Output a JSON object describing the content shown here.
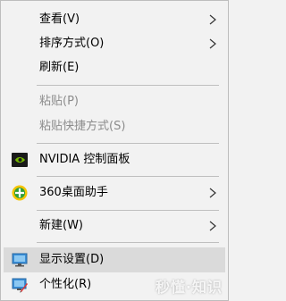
{
  "menu": {
    "items": [
      {
        "label": "查看(V)"
      },
      {
        "label": "排序方式(O)"
      },
      {
        "label": "刷新(E)"
      },
      {
        "label": "粘贴(P)"
      },
      {
        "label": "粘贴快捷方式(S)"
      },
      {
        "label": "NVIDIA 控制面板",
        "icon": "nvidia-icon"
      },
      {
        "label": "360桌面助手",
        "icon": "360-icon"
      },
      {
        "label": "新建(W)"
      },
      {
        "label": "显示设置(D)",
        "icon": "display-icon"
      },
      {
        "label": "个性化(R)",
        "icon": "personalize-icon"
      }
    ]
  },
  "watermark": "秒懂·知识",
  "colors": {
    "background": "#f2f2f2",
    "hover": "#dadada",
    "disabled_text": "#8c8c8c",
    "separator": "#bfbfbf",
    "nvidia_green": "#76b900",
    "icon_360": "#f5c400"
  }
}
